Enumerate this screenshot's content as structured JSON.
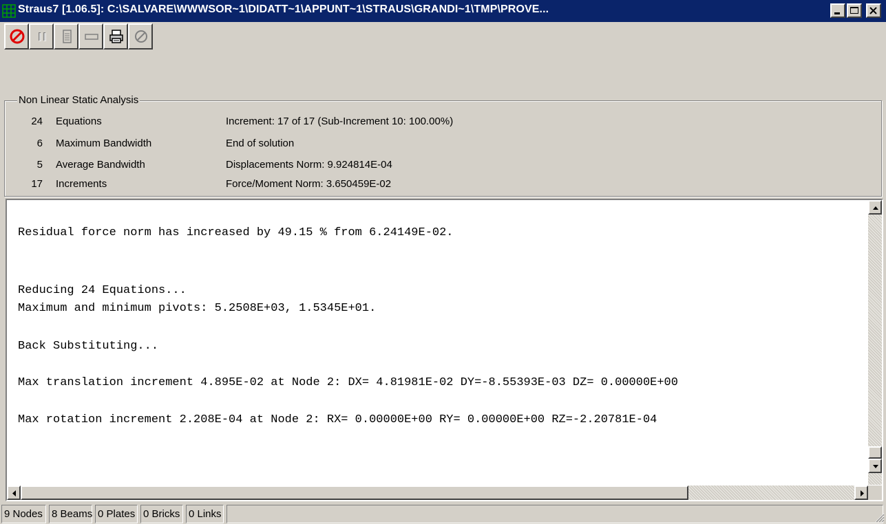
{
  "window": {
    "title": "Straus7 [1.06.5]: C:\\SALVARE\\WWWSOR~1\\DIDATT~1\\APPUNT~1\\STRAUS\\GRANDI~1\\TMP\\PROVE..."
  },
  "toolbar": {
    "buttons": [
      {
        "icon": "stop-icon",
        "enabled": true
      },
      {
        "icon": "pause-icon",
        "enabled": false
      },
      {
        "icon": "document-icon",
        "enabled": false
      },
      {
        "icon": "minimize-window-icon",
        "enabled": false
      },
      {
        "icon": "print-icon",
        "enabled": true
      },
      {
        "icon": "refresh-icon",
        "enabled": false
      }
    ]
  },
  "analysis": {
    "title": "Non Linear Static Analysis",
    "stats": [
      {
        "value": "24",
        "label": "Equations"
      },
      {
        "value": "6",
        "label": "Maximum Bandwidth"
      },
      {
        "value": "5",
        "label": "Average Bandwidth"
      },
      {
        "value": "17",
        "label": "Increments"
      }
    ],
    "status": [
      "Increment:  17 of  17 (Sub-Increment 10:  100.00%)",
      "End of solution",
      "Displacements Norm:  9.924814E-04",
      "Force/Moment Norm:  3.650459E-02"
    ]
  },
  "log": {
    "lines": [
      "Residual force norm has increased by 49.15 % from 6.24149E-02.",
      "Reducing 24 Equations...",
      "Maximum and minimum pivots: 5.2508E+03, 1.5345E+01.",
      "Back Substituting...",
      "Max translation increment 4.895E-02 at Node 2: DX= 4.81981E-02 DY=-8.55393E-03 DZ= 0.00000E+00",
      "Max rotation increment 2.208E-04 at Node 2: RX= 0.00000E+00 RY= 0.00000E+00 RZ=-2.20781E-04"
    ]
  },
  "statusbar": {
    "nodes": "9 Nodes",
    "beams": "8 Beams",
    "plates": "0 Plates",
    "bricks": "0 Bricks",
    "links": "0 Links"
  },
  "colors": {
    "titlebar": "#0a246a",
    "face": "#d4d0c8",
    "stop_red": "#e00000"
  }
}
